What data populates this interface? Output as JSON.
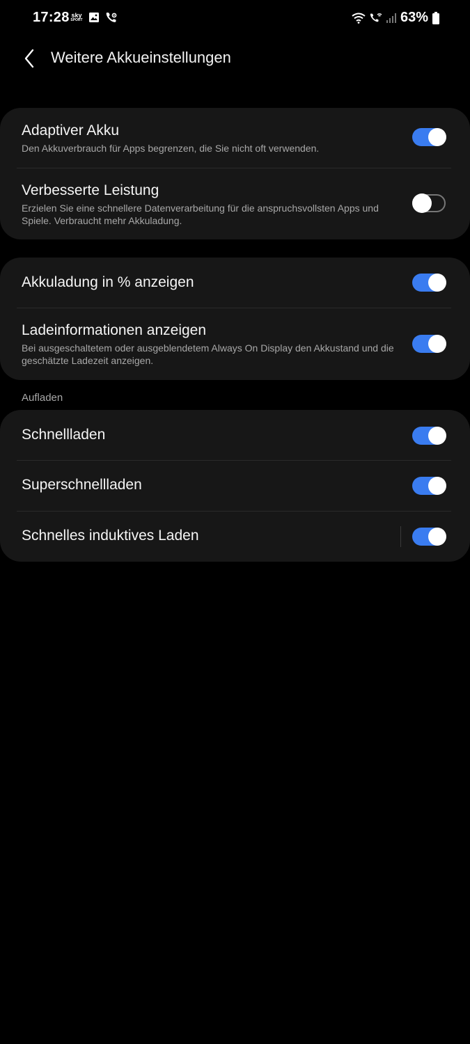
{
  "status_bar": {
    "time": "17:28",
    "battery": "63%",
    "icons": [
      "sky-sport-icon",
      "image-icon",
      "wifi-call-icon",
      "wifi-icon",
      "vowifi-icon",
      "signal-icon",
      "battery-icon"
    ]
  },
  "header": {
    "back_icon": "chevron-left-icon",
    "title": "Weitere Akkueinstellungen"
  },
  "settings": {
    "adaptive": {
      "title": "Adaptiver Akku",
      "subtitle": "Den Akkuverbrauch für Apps begrenzen, die Sie nicht oft verwenden.",
      "enabled": true
    },
    "performance": {
      "title": "Verbesserte Leistung",
      "subtitle": "Erzielen Sie eine schnellere Datenverarbeitung für die anspruchsvollsten Apps und Spiele. Verbraucht mehr Akkuladung.",
      "enabled": false
    },
    "percent": {
      "title": "Akkuladung in % anzeigen",
      "enabled": true
    },
    "charge_info": {
      "title": "Ladeinformationen anzeigen",
      "subtitle": "Bei ausgeschaltetem oder ausgeblendetem Always On Display den Akkustand und die geschätzte Ladezeit anzeigen.",
      "enabled": true
    }
  },
  "charging": {
    "section_label": "Aufladen",
    "fast": {
      "title": "Schnellladen",
      "enabled": true
    },
    "super_fast": {
      "title": "Superschnellladen",
      "enabled": true
    },
    "wireless": {
      "title": "Schnelles induktives Laden",
      "enabled": true
    }
  },
  "colors": {
    "background": "#000000",
    "card": "#171717",
    "toggle_on": "#3a7cf0",
    "secondary_text": "#a8a8a8"
  }
}
